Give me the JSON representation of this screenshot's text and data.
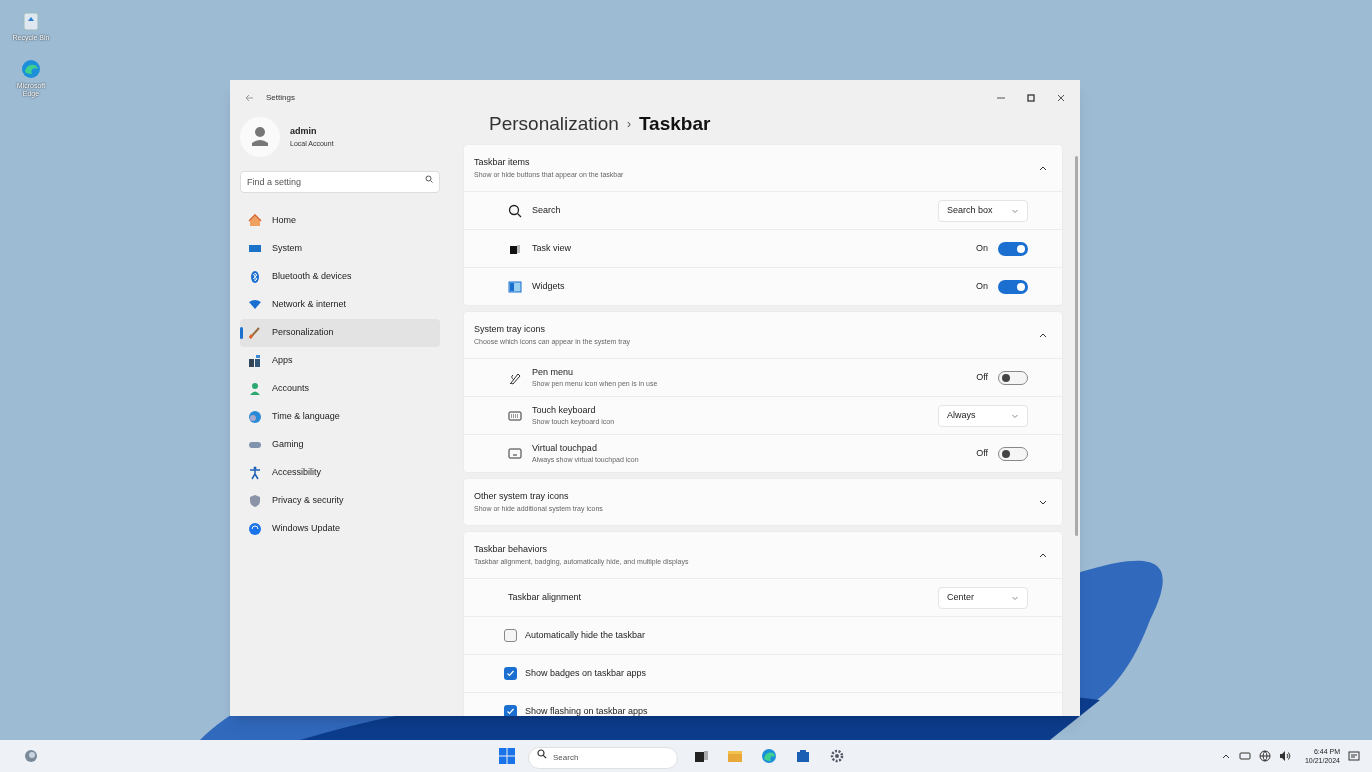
{
  "desktop_icons": [
    {
      "label": "Recycle Bin"
    },
    {
      "label": "Microsoft Edge"
    }
  ],
  "window": {
    "title": "Settings"
  },
  "account": {
    "name": "admin",
    "type": "Local Account"
  },
  "search": {
    "placeholder": "Find a setting"
  },
  "nav": [
    {
      "label": "Home",
      "selected": false
    },
    {
      "label": "System",
      "selected": false
    },
    {
      "label": "Bluetooth & devices",
      "selected": false
    },
    {
      "label": "Network & internet",
      "selected": false
    },
    {
      "label": "Personalization",
      "selected": true
    },
    {
      "label": "Apps",
      "selected": false
    },
    {
      "label": "Accounts",
      "selected": false
    },
    {
      "label": "Time & language",
      "selected": false
    },
    {
      "label": "Gaming",
      "selected": false
    },
    {
      "label": "Accessibility",
      "selected": false
    },
    {
      "label": "Privacy & security",
      "selected": false
    },
    {
      "label": "Windows Update",
      "selected": false
    }
  ],
  "breadcrumb": {
    "parent": "Personalization",
    "separator": "›",
    "current": "Taskbar"
  },
  "sections": [
    {
      "title": "Taskbar items",
      "subtitle": "Show or hide buttons that appear on the taskbar",
      "expanded": true,
      "rows": [
        {
          "kind": "dropdown",
          "label": "Search",
          "value": "Search box"
        },
        {
          "kind": "toggle",
          "label": "Task view",
          "state_label": "On",
          "on": true
        },
        {
          "kind": "toggle",
          "label": "Widgets",
          "state_label": "On",
          "on": true
        }
      ]
    },
    {
      "title": "System tray icons",
      "subtitle": "Choose which icons can appear in the system tray",
      "expanded": true,
      "rows": [
        {
          "kind": "toggle",
          "label": "Pen menu",
          "description": "Show pen menu icon when pen is in use",
          "state_label": "Off",
          "on": false
        },
        {
          "kind": "dropdown",
          "label": "Touch keyboard",
          "description": "Show touch keyboard icon",
          "value": "Always"
        },
        {
          "kind": "toggle",
          "label": "Virtual touchpad",
          "description": "Always show virtual touchpad icon",
          "state_label": "Off",
          "on": false
        }
      ]
    },
    {
      "title": "Other system tray icons",
      "subtitle": "Show or hide additional system tray icons",
      "expanded": false
    },
    {
      "title": "Taskbar behaviors",
      "subtitle": "Taskbar alignment, badging, automatically hide, and multiple displays",
      "expanded": true,
      "rows": [
        {
          "kind": "dropdown",
          "label": "Taskbar alignment",
          "value": "Center"
        },
        {
          "kind": "checkbox",
          "label": "Automatically hide the taskbar",
          "checked": false
        },
        {
          "kind": "checkbox",
          "label": "Show badges on taskbar apps",
          "checked": true
        },
        {
          "kind": "checkbox",
          "label": "Show flashing on taskbar apps",
          "checked": true
        }
      ]
    }
  ],
  "taskbar": {
    "search_placeholder": "Search",
    "time": "6:44 PM",
    "date": "10/21/2024"
  }
}
